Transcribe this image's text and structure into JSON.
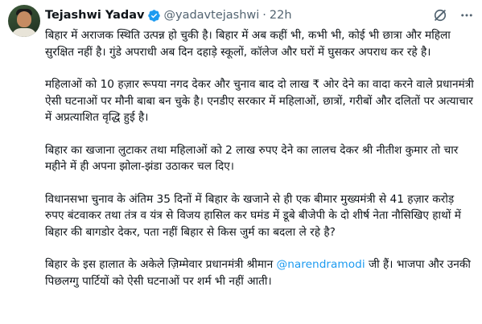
{
  "tweet": {
    "author_name": "Tejashwi Yadav",
    "handle": "@yadavtejashwi",
    "separator": "·",
    "time": "22h",
    "paragraphs": [
      "बिहार में अराजक स्थिति उत्पन्न हो चुकी है। बिहार में अब कहीं भी, कभी भी, कोई भी छात्रा और महिला सुरक्षित नहीं है। गुंडे अपराधी अब दिन दहाड़े स्कूलों, कॉलेज और घरों में घुसकर अपराध कर रहे है।",
      "महिलाओं को 10 हज़ार रूपया नगद देकर और चुनाव बाद दो लाख ₹ ओर देने का वादा करने वाले प्रधानमंत्री ऐसी घटनाओं पर मौनी बाबा बन चुके है। एनडीए सरकार में महिलाओं, छात्रों, गरीबों और दलितों पर अत्याचार में अप्रत्याशित वृद्धि हुई है।",
      "बिहार का खजाना लुटाकर तथा महिलाओं को 2 लाख रुपए देने का लालच देकर श्री नीतीश कुमार तो चार महीने में ही अपना झोला-झंडा उठाकर चल दिए।",
      "विधानसभा चुनाव के अंतिम 35 दिनों में बिहार के खजाने से ही एक बीमार मुख्यमंत्री से 41 हज़ार करोड़ रुपए बंटवाकर तथा तंत्र व यंत्र से विजय हासिल कर घमंड में डूबे बीजेपी के दो शीर्ष नेता नौसिखिए हाथों में बिहार की बागडोर देकर, पता नहीं बिहार से किस जुर्म का बदला ले रहे है?"
    ],
    "last_paragraph": {
      "before": "बिहार के इस हालात के अकेले ज़िम्मेवार प्रधानमंत्री श्रीमान ",
      "mention": "@narendramodi",
      "after": " जी हैं। भाजपा और उनकी पिछलग्गु पार्टियों को ऐसी घटनाओं पर शर्म भी नहीं आती।"
    }
  },
  "icons": {
    "verified": "verified-badge-icon",
    "grok": "grok-icon",
    "more": "more-options-icon"
  },
  "colors": {
    "text": "#0f1419",
    "secondary": "#536471",
    "accent": "#1d9bf0"
  }
}
